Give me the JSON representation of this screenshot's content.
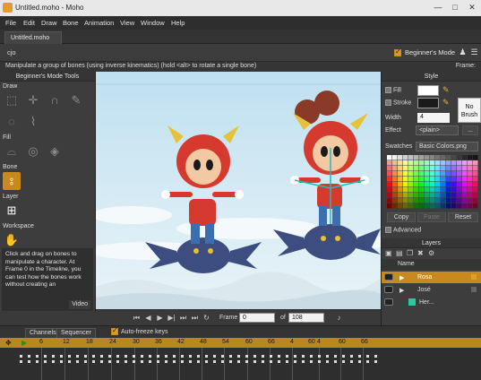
{
  "window": {
    "title": "Untitled.moho - Moho",
    "controls": [
      "minimize",
      "maximize",
      "close"
    ]
  },
  "menu": [
    "File",
    "Edit",
    "Draw",
    "Bone",
    "Animation",
    "View",
    "Window",
    "Help"
  ],
  "document_tab": "Untitled.moho",
  "toolbar": {
    "cjo_label": "cjo",
    "beginner_mode_label": "Beginner's Mode"
  },
  "status": {
    "message": "Manipulate a group of bones (using inverse kinematics) (hold <alt> to rotate a single bone)",
    "frame_label": "Frame:"
  },
  "tools_panel": {
    "title": "Beginner's Mode Tools",
    "sections": {
      "draw": "Draw",
      "fill": "Fill",
      "bone": "Bone",
      "layer": "Layer",
      "workspace": "Workspace"
    },
    "info_text": "Click and drag on bones to manipulate a character. At Frame 0 in the Timeline, you can test how the bones work without creating an",
    "video_button": "Video"
  },
  "canvas_controls": {
    "frame_label": "Frame",
    "frame_value": "0",
    "of_label": "of",
    "total_frames": "108"
  },
  "style_panel": {
    "title": "Style",
    "fill_label": "Fill",
    "stroke_label": "Stroke",
    "width_label": "Width",
    "width_value": "4",
    "no_brush_label": "No Brush",
    "effect_label": "Effect",
    "effect_value": "<plain>",
    "swatches_label": "Swatches",
    "swatches_value": "Basic Colors.png",
    "copy_button": "Copy",
    "paste_button": "Paste",
    "reset_button": "Reset",
    "advanced_label": "Advanced",
    "colors": {
      "fill": "#ffffff",
      "stroke": "#1a1a1a"
    }
  },
  "layers_panel": {
    "title": "Layers",
    "name_header": "Name",
    "layers": [
      {
        "name": "Rosa",
        "selected": true,
        "color": "#e0a020"
      },
      {
        "name": "José",
        "selected": false,
        "color": "#666666"
      },
      {
        "name": "Her...",
        "selected": false,
        "color": "#35c4a0"
      }
    ]
  },
  "timeline": {
    "tabs": [
      "Channels",
      "Sequencer"
    ],
    "autofreeze_label": "Auto-freeze keys",
    "ruler_ticks": [
      "6",
      "12",
      "18",
      "24",
      "30",
      "36",
      "42",
      "48",
      "54",
      "60",
      "66",
      "4",
      "60",
      "4",
      "60",
      "66"
    ]
  },
  "accent_color": "#c8891d"
}
